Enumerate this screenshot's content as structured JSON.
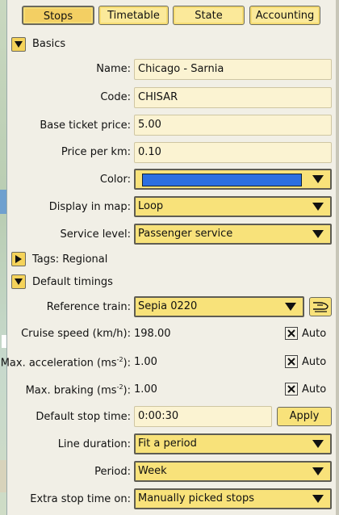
{
  "tabs": [
    {
      "label": "Stops",
      "active": true
    },
    {
      "label": "Timetable"
    },
    {
      "label": "State"
    },
    {
      "label": "Accounting"
    }
  ],
  "basics": {
    "title": "Basics",
    "name_label": "Name:",
    "name_value": "Chicago - Sarnia",
    "code_label": "Code:",
    "code_value": "CHISAR",
    "ticket_label": "Base ticket price:",
    "ticket_value": "5.00",
    "perkm_label": "Price per km:",
    "perkm_value": "0.10",
    "color_label": "Color:",
    "color_value": "#2c6fe0",
    "display_label": "Display in map:",
    "display_value": "Loop",
    "service_label": "Service level:",
    "service_value": "Passenger service"
  },
  "tags": {
    "title": "Tags: Regional"
  },
  "timings": {
    "title": "Default timings",
    "ref_label": "Reference train:",
    "ref_value": "Sepia 0220",
    "cruise_label": "Cruise speed (km/h):",
    "cruise_value": "198.00",
    "cruise_auto": "Auto",
    "accel_label": "Max. acceleration (ms",
    "accel_sup": "-2",
    "accel_label_end": "):",
    "accel_value": "1.00",
    "accel_auto": "Auto",
    "brake_label": "Max. braking (ms",
    "brake_sup": "-2",
    "brake_label_end": "):",
    "brake_value": "1.00",
    "brake_auto": "Auto",
    "stop_label": "Default stop time:",
    "stop_value": "0:00:30",
    "apply_label": "Apply",
    "line_label": "Line duration:",
    "line_value": "Fit a period",
    "period_label": "Period:",
    "period_value": "Week",
    "extra_label": "Extra stop time on:",
    "extra_value": "Manually picked stops"
  },
  "icons": {
    "expand": "triangle-down-icon",
    "collapsed": "triangle-right-icon",
    "train": "train-icon",
    "checkbox": "x-checkbox-icon"
  }
}
